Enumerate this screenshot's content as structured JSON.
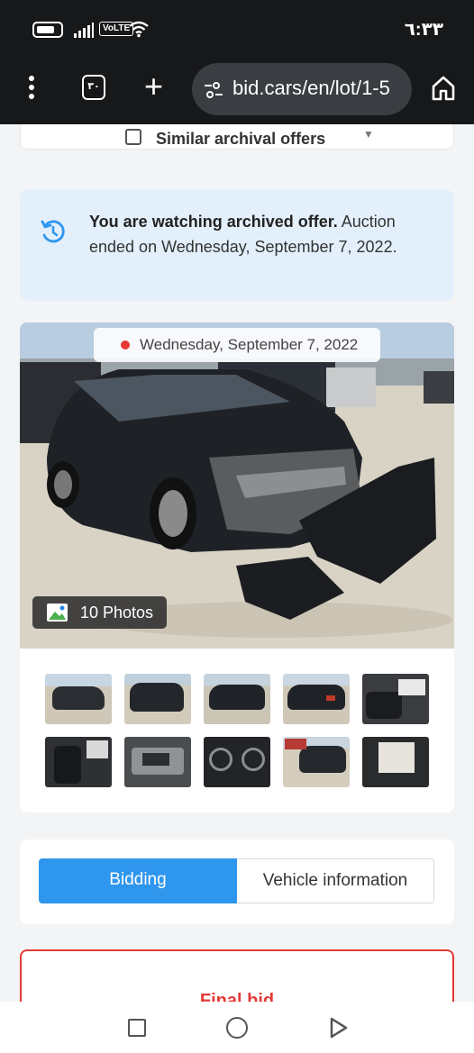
{
  "status_bar": {
    "time": "٦:٣٣",
    "network_badge": "VoLTE",
    "icons": [
      "battery-icon",
      "signal-icon",
      "wifi-icon"
    ]
  },
  "browser": {
    "tab_count": "٣٠",
    "url": "bid.cars/en/lot/1-5",
    "icons": [
      "menu-icon",
      "tab-switcher-icon",
      "new-tab-icon",
      "site-settings-icon",
      "home-icon"
    ]
  },
  "page": {
    "similar_offers_label": "Similar archival offers",
    "archive_notice": {
      "bold": "You are watching archived offer.",
      "rest": " Auction ended on Wednesday, September 7, 2022."
    },
    "auction_date": "Wednesday, September 7, 2022",
    "photos_count": "10 Photos",
    "thumbnail_count": 10,
    "tabs": [
      {
        "label": "Bidding",
        "active": true
      },
      {
        "label": "Vehicle information",
        "active": false
      }
    ],
    "final_bid_label": "Final bid"
  },
  "nav_bar": {
    "icons": [
      "recents-icon",
      "home-circle-icon",
      "back-icon"
    ]
  },
  "colors": {
    "accent": "#2f96ee",
    "notice_bg": "#e3f0fc",
    "status_dot": "#e53935",
    "final_bid_border": "#e53935"
  }
}
